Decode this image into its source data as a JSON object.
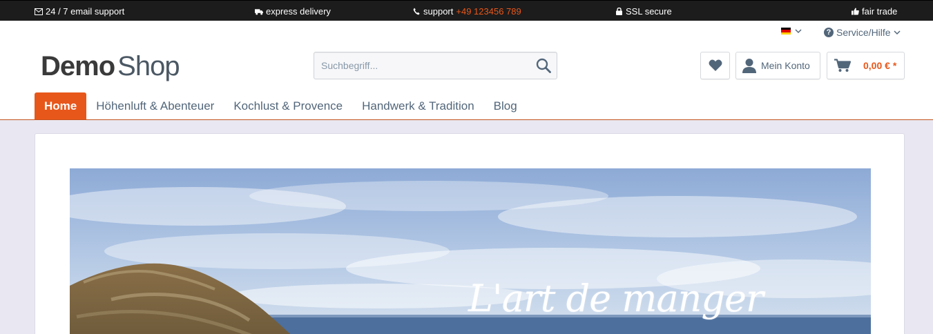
{
  "topbar": {
    "email_support": "24 / 7 email support",
    "express_delivery": "express delivery",
    "support_label": "support",
    "support_phone": "+49 123456 789",
    "ssl": "SSL secure",
    "fair_trade": "fair trade"
  },
  "header": {
    "language_flag": "de-flag-icon",
    "service_label": "Service/Hilfe",
    "logo_bold": "Demo",
    "logo_light": "Shop",
    "search_placeholder": "Suchbegriff...",
    "account_label": "Mein Konto",
    "cart_amount": "0,00 € *"
  },
  "nav": {
    "items": [
      "Home",
      "Höhenluft & Abenteuer",
      "Kochlust & Provence",
      "Handwerk & Tradition",
      "Blog"
    ],
    "active_index": 0
  },
  "banner": {
    "text": "L'art de manger"
  },
  "colors": {
    "accent": "#e8571a",
    "topbar_bg": "#1c1c1c",
    "page_bg": "#e9e8f2",
    "text": "#52667a"
  }
}
